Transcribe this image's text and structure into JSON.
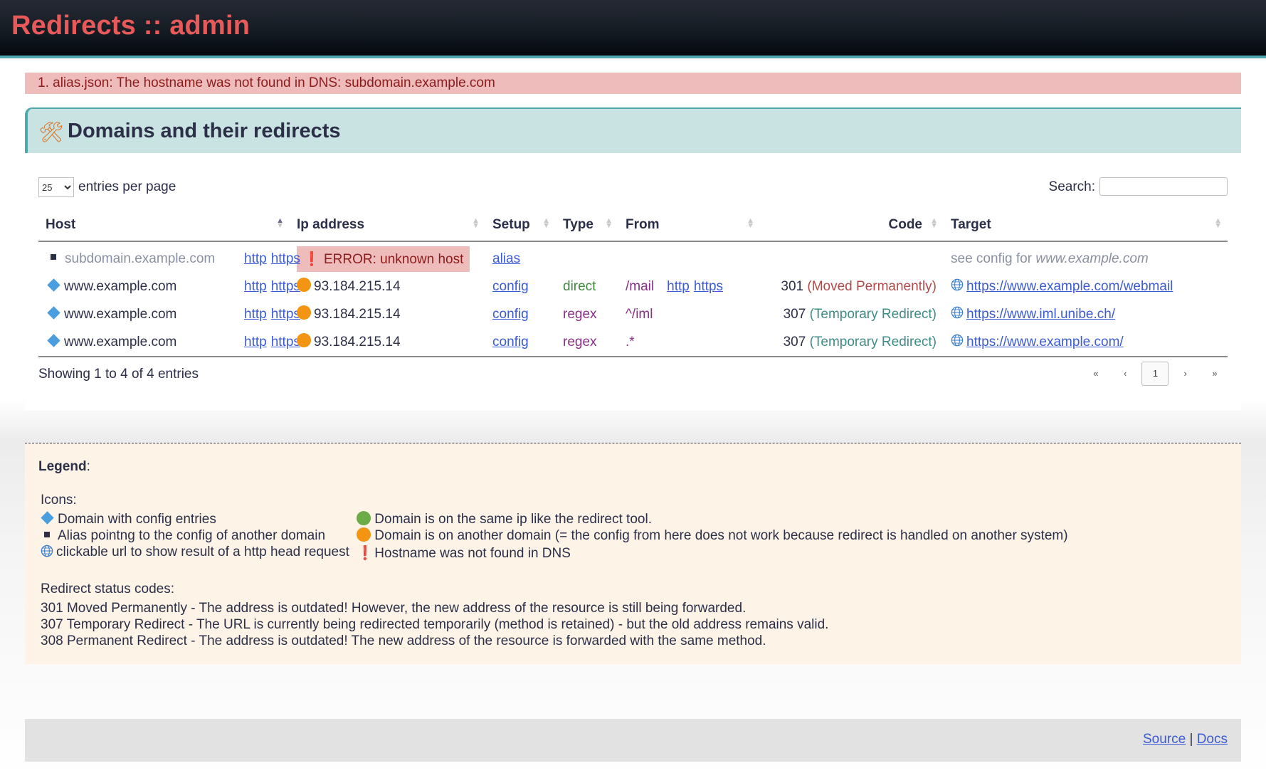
{
  "app": {
    "title": "Redirects :: admin"
  },
  "alerts": [
    "1. alias.json: The hostname was not found in DNS: subdomain.example.com"
  ],
  "panel": {
    "icon": "tools-icon",
    "title": "Domains and their redirects",
    "per_page_value": "25",
    "per_page_label": "entries per page",
    "search_label": "Search:",
    "search_value": "",
    "columns": [
      "Host",
      "Ip address",
      "Setup",
      "Type",
      "From",
      "Code",
      "Target"
    ],
    "rows": [
      {
        "host": "subdomain.example.com",
        "host_icon": "square-icon",
        "links": [
          "http",
          "https"
        ],
        "ip": "ERROR: unknown host",
        "ip_icon": "exclamation-icon",
        "setup": "alias",
        "type": "",
        "from": "",
        "from_links": [],
        "code": "",
        "code_text": "",
        "target_prefix": "see config for ",
        "target": "www.example.com"
      },
      {
        "host": "www.example.com",
        "host_icon": "diamond-icon",
        "links": [
          "http",
          "https"
        ],
        "ip": "93.184.215.14",
        "ip_icon": "orange-circle-icon",
        "setup": "config",
        "type": "direct",
        "from": "/mail",
        "from_links": [
          "http",
          "https"
        ],
        "code": "301",
        "code_text": "(Moved Permanently)",
        "target_prefix": "",
        "target": "https://www.example.com/webmail"
      },
      {
        "host": "www.example.com",
        "host_icon": "diamond-icon",
        "links": [
          "http",
          "https"
        ],
        "ip": "93.184.215.14",
        "ip_icon": "orange-circle-icon",
        "setup": "config",
        "type": "regex",
        "from": "^/iml",
        "from_links": [],
        "code": "307",
        "code_text": "(Temporary Redirect)",
        "target_prefix": "",
        "target": "https://www.iml.unibe.ch/"
      },
      {
        "host": "www.example.com",
        "host_icon": "diamond-icon",
        "links": [
          "http",
          "https"
        ],
        "ip": "93.184.215.14",
        "ip_icon": "orange-circle-icon",
        "setup": "config",
        "type": "regex",
        "from": ".*",
        "from_links": [],
        "code": "307",
        "code_text": "(Temporary Redirect)",
        "target_prefix": "",
        "target": "https://www.example.com/"
      }
    ],
    "info": "Showing 1 to 4 of 4 entries",
    "pager": [
      "«",
      "‹",
      "1",
      "›",
      "»"
    ]
  },
  "legend": {
    "title": "Legend",
    "title_suffix": ":",
    "icons_heading": "Icons:",
    "icons_left": [
      {
        "icon": "diamond-icon",
        "text": "Domain with config entries"
      },
      {
        "icon": "square-icon",
        "text": "Alias pointng to the config of another domain"
      },
      {
        "icon": "globe-icon",
        "text": "clickable url to show result of a http head request"
      }
    ],
    "icons_right": [
      {
        "icon": "green-circle-icon",
        "text": "Domain is on the same ip like the redirect tool."
      },
      {
        "icon": "orange-circle-icon",
        "text": "Domain is on another domain (= the config from here does not work because redirect is handled on another system)"
      },
      {
        "icon": "exclamation-icon",
        "text": "Hostname was not found in DNS"
      }
    ],
    "codes_heading": "Redirect status codes:",
    "codes": [
      "301 Moved Permanently - The address is outdated! However, the new address of the resource is still being forwarded.",
      "307 Temporary Redirect - The URL is currently being redirected temporarily (method is retained) - but the old address remains valid.",
      "308 Permanent Redirect - The address is outdated! The new address of the resource is forwarded with the same method."
    ]
  },
  "footer": {
    "source": "Source",
    "separator": "|",
    "docs": "Docs"
  },
  "colors": {
    "accent": "#4fa8ab",
    "title": "#e85a5a",
    "error_bg": "#efbcbc",
    "link": "#3b5bd6"
  }
}
